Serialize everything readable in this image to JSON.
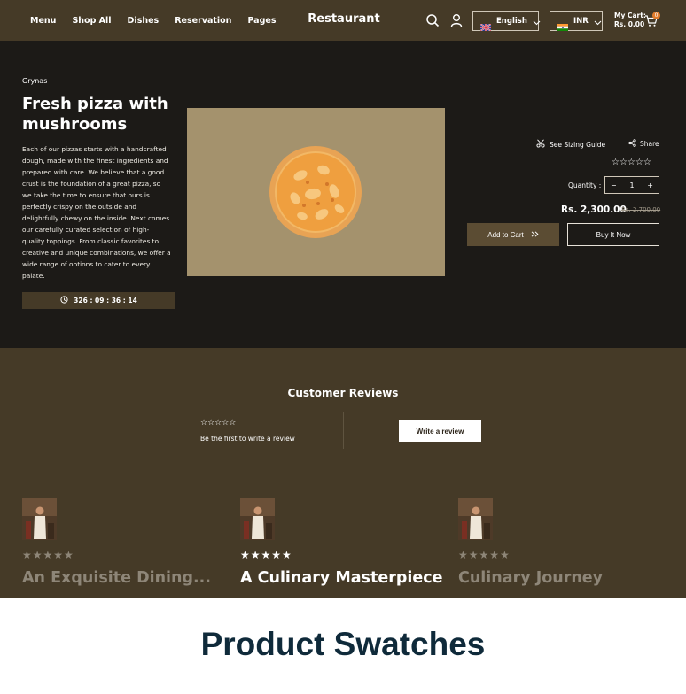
{
  "header": {
    "nav": [
      "Menu",
      "Shop All",
      "Dishes",
      "Reservation",
      "Pages"
    ],
    "brand": "Restaurant",
    "language": "English",
    "currency": "INR",
    "cart_label": "My Cart:",
    "cart_amount": "Rs. 0.00",
    "cart_count": "0"
  },
  "product": {
    "vendor": "Grynas",
    "title": "Fresh pizza with mushrooms",
    "description": "Each of our pizzas starts with a handcrafted dough, made with the finest ingredients and prepared with care. We believe that a good crust is the foundation of a great pizza, so we take the time to ensure that ours is perfectly crispy on the outside and delightfully chewy on the inside. Next comes our carefully curated selection of high-quality toppings. From classic favorites to creative and unique combinations, we offer a wide range of options to cater to every palate.",
    "countdown": "326 : 09 : 36 : 14",
    "sizing_guide": "See Sizing Guide",
    "share": "Share",
    "rating_stars": "☆☆☆☆☆",
    "quantity_label": "Quantity :",
    "quantity_value": "1",
    "qty_minus": "−",
    "qty_plus": "+",
    "price": "Rs. 2,300.00",
    "compare_price": "Rs. 2,700.00",
    "add_to_cart": "Add to Cart",
    "buy_now": "Buy It Now"
  },
  "reviews": {
    "title": "Customer Reviews",
    "empty_stars": "☆☆☆☆☆",
    "empty_text": "Be the first to write a review",
    "write_button": "Write a review",
    "cards": [
      {
        "stars": "★★★★★",
        "title": "An Exquisite Dining..."
      },
      {
        "stars": "★★★★★",
        "title": "A Culinary Masterpiece"
      },
      {
        "stars": "★★★★★",
        "title": "Culinary Journey"
      }
    ]
  },
  "caption": "Product Swatches",
  "colors": {
    "header_bg": "#453a27",
    "page_bg": "#1c1a17",
    "image_bg": "#a4926d",
    "badge": "#e07b2a",
    "caption": "#0f2a3a"
  }
}
